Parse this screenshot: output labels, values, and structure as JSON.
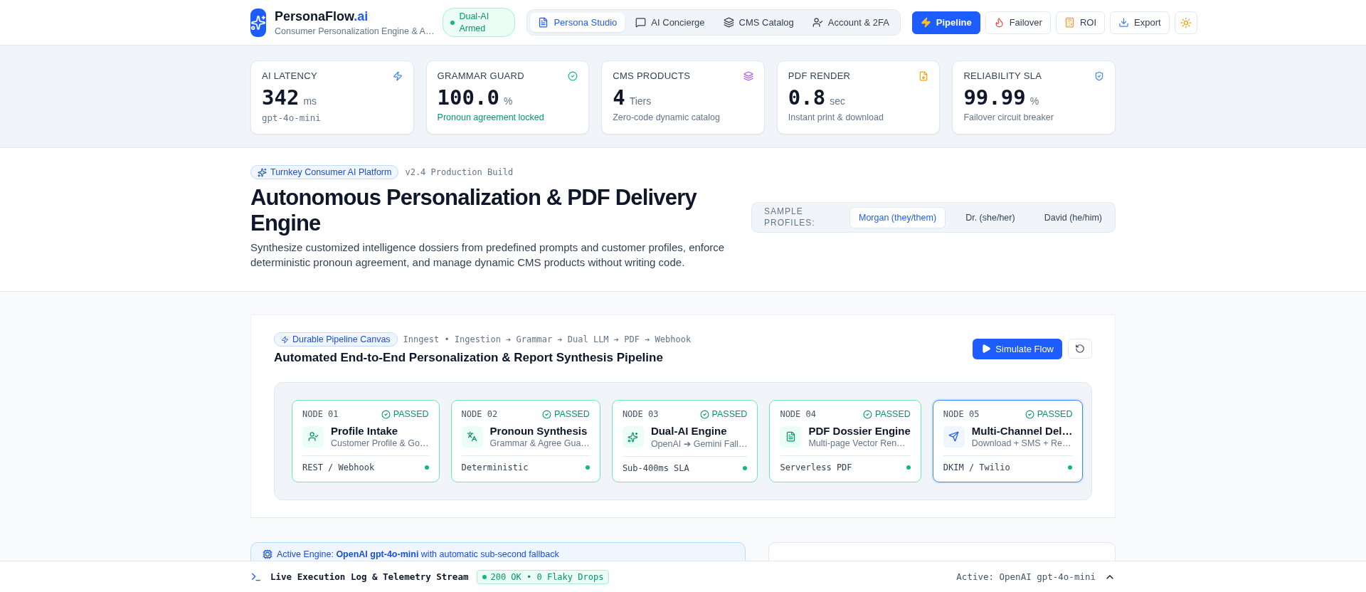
{
  "brand": {
    "name": "PersonaFlow",
    "suffix": ".ai",
    "badge": "Dual-AI Armed",
    "tagline": "Consumer Personalization Engine & A…"
  },
  "nav_tabs": [
    {
      "label": "Persona Studio",
      "selected": true
    },
    {
      "label": "AI Concierge",
      "selected": false
    },
    {
      "label": "CMS Catalog",
      "selected": false
    },
    {
      "label": "Account & 2FA",
      "selected": false
    }
  ],
  "actions": [
    {
      "label": "Pipeline",
      "kind": "primary"
    },
    {
      "label": "Failover",
      "kind": "outline"
    },
    {
      "label": "ROI",
      "kind": "outline"
    },
    {
      "label": "Export",
      "kind": "outline"
    }
  ],
  "stats": [
    {
      "label": "AI LATENCY",
      "value": "342",
      "unit": "ms",
      "note": "gpt-4o-mini",
      "kind": "mono"
    },
    {
      "label": "GRAMMAR GUARD",
      "value": "100.0",
      "unit": "%",
      "note": "Pronoun agreement locked",
      "kind": "success"
    },
    {
      "label": "CMS PRODUCTS",
      "value": "4",
      "unit": "Tiers",
      "note": "Zero-code dynamic catalog",
      "kind": "plain"
    },
    {
      "label": "PDF RENDER",
      "value": "0.8",
      "unit": "sec",
      "note": "Instant print & download",
      "kind": "plain"
    },
    {
      "label": "RELIABILITY SLA",
      "value": "99.99",
      "unit": "%",
      "note": "Failover circuit breaker",
      "kind": "plain"
    }
  ],
  "hero": {
    "badge": "Turnkey Consumer AI Platform",
    "build": "v2.4 Production Build",
    "title": "Autonomous Personalization & PDF Delivery Engine",
    "description": "Synthesize customized intelligence dossiers from predefined prompts and customer profiles, enforce deterministic pronoun agreement, and manage dynamic CMS products without writing code."
  },
  "profiles": {
    "label": "SAMPLE PROFILES:",
    "items": [
      {
        "label": "Morgan (they/them)",
        "selected": true
      },
      {
        "label": "Dr. (she/her)",
        "selected": false
      },
      {
        "label": "David (he/him)",
        "selected": false
      }
    ]
  },
  "pipeline": {
    "badge": "Durable Pipeline Canvas",
    "flow": "Inngest • Ingestion ➔ Grammar ➔ Dual LLM ➔ PDF ➔ Webhook",
    "title": "Automated End-to-End Personalization & Report Synthesis Pipeline",
    "run_button": "Simulate Flow",
    "nodes": [
      {
        "label": "NODE 01",
        "status": "PASSED",
        "title": "Profile Intake",
        "subtitle": "Customer Profile & Go…",
        "footer": "REST / Webhook",
        "active": false
      },
      {
        "label": "NODE 02",
        "status": "PASSED",
        "title": "Pronoun Synthesis",
        "subtitle": "Grammar & Agree Gua…",
        "footer": "Deterministic",
        "active": false
      },
      {
        "label": "NODE 03",
        "status": "PASSED",
        "title": "Dual-AI Engine",
        "subtitle": "OpenAI ➔ Gemini Fall…",
        "footer": "Sub-400ms SLA",
        "active": false
      },
      {
        "label": "NODE 04",
        "status": "PASSED",
        "title": "PDF Dossier Engine",
        "subtitle": "Multi-page Vector Ren…",
        "footer": "Serverless PDF",
        "active": false
      },
      {
        "label": "NODE 05",
        "status": "PASSED",
        "title": "Multi-Channel Del…",
        "subtitle": "Download + SMS + Re…",
        "footer": "DKIM / Twilio",
        "active": true
      }
    ]
  },
  "engine_notice": "Active Engine: **OpenAI gpt-4o-mini** with automatic sub-second fallback",
  "footer": {
    "title": "Live Execution Log & Telemetry Stream",
    "status": "200 OK • 0 Flaky Drops",
    "active": "Active: OpenAI gpt-4o-mini"
  }
}
